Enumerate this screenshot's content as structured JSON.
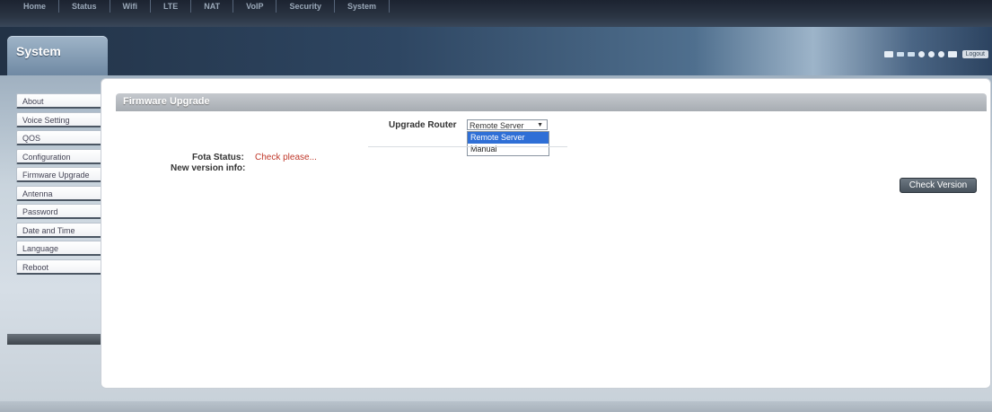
{
  "topnav": {
    "items": [
      "Home",
      "Status",
      "Wifi",
      "LTE",
      "NAT",
      "VoIP",
      "Security",
      "System"
    ]
  },
  "section": {
    "title": "System"
  },
  "header_icons": [
    "monitor-icon",
    "signal-icon",
    "antenna-icon",
    "globe-icon",
    "settings-icon",
    "message-icon",
    "mail-icon"
  ],
  "header": {
    "logout_label": "Logout"
  },
  "sidebar": {
    "items": [
      {
        "label": "About"
      },
      {
        "label": "Voice Setting"
      },
      {
        "label": "QOS"
      },
      {
        "label": "Configuration"
      },
      {
        "label": "Firmware Upgrade"
      },
      {
        "label": "Antenna"
      },
      {
        "label": "Password"
      },
      {
        "label": "Date and Time"
      },
      {
        "label": "Language"
      },
      {
        "label": "Reboot"
      }
    ]
  },
  "panel": {
    "title": "Firmware Upgrade",
    "upgrade_router_label": "Upgrade Router",
    "upgrade_router_value": "Remote Server",
    "upgrade_router_options": [
      "Remote Server",
      "Manual"
    ],
    "fota_status_label": "Fota Status:",
    "fota_status_value": "Check please...",
    "new_version_label": "New version info:",
    "check_version_button": "Check Version"
  },
  "colors": {
    "fota_status": "#c0392b",
    "selected_option": "#2f6fd6"
  }
}
